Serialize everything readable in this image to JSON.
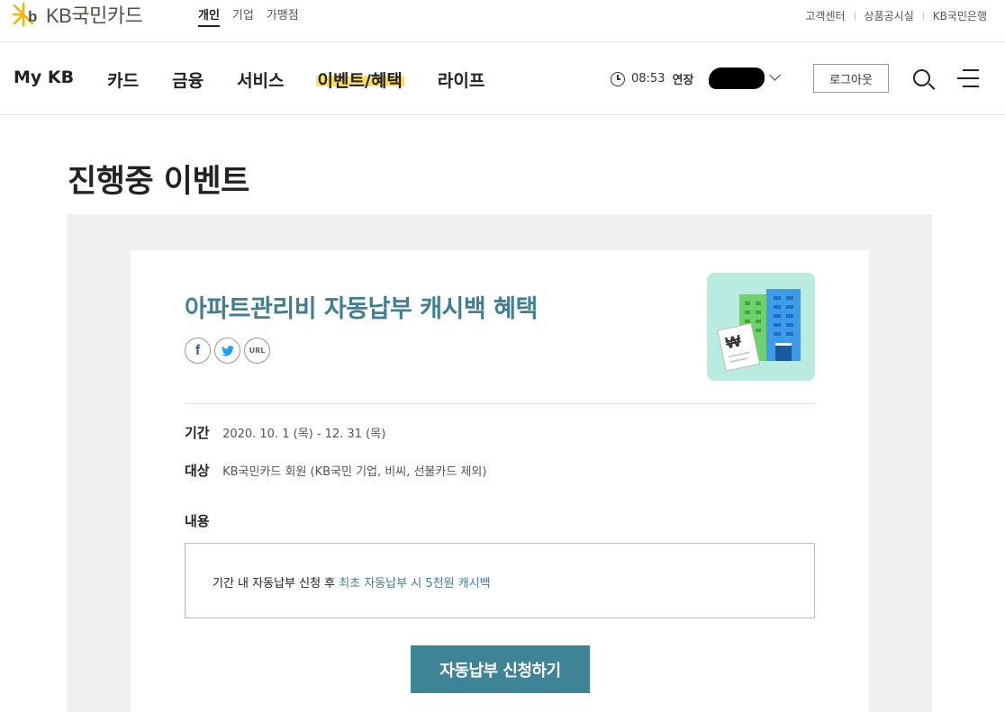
{
  "brand": {
    "logo_text": "KB국민카드",
    "accent": "#f5b500"
  },
  "segments": [
    "개인",
    "기업",
    "가맹점"
  ],
  "util_links": [
    "고객센터",
    "상품공시실",
    "KB국민은행"
  ],
  "menu": [
    "My KB",
    "카드",
    "금융",
    "서비스",
    "이벤트/혜택",
    "라이프"
  ],
  "session": {
    "time": "08:53",
    "extend_label": "연장"
  },
  "logout_label": "로그아웃",
  "page_title": "진행중 이벤트",
  "event": {
    "title": "아파트관리비 자동납부 캐시백 혜택",
    "share": {
      "facebook": "f",
      "url": "URL"
    },
    "period_label": "기간",
    "period_value": "2020. 10. 1 (목) - 12. 31 (목)",
    "target_label": "대상",
    "target_value": "KB국민카드 회원 (KB국민 기업, 비씨, 선불카드 제외)",
    "content_label": "내용",
    "content_prefix": "기간 내 자동납부 신청 후 ",
    "content_highlight": "최초 자동납부 시 5천원 캐시백",
    "apply_label": "자동납부 신청하기"
  },
  "colors": {
    "title_teal": "#3e7f95",
    "button_teal": "#3e8496",
    "highlight_yellow": "#ffde5a"
  }
}
